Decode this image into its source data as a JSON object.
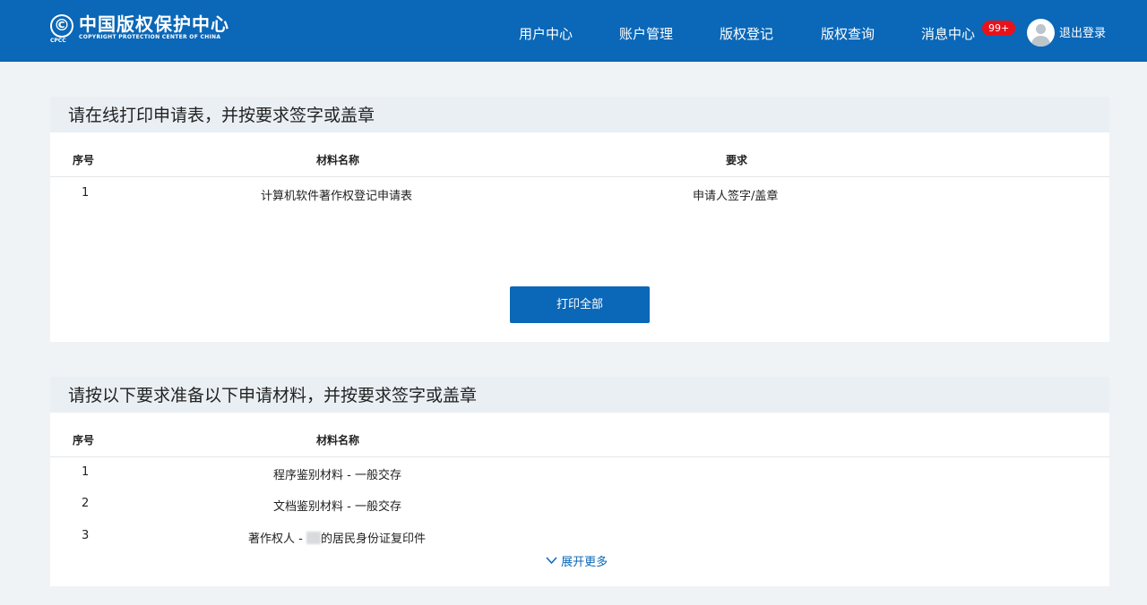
{
  "header": {
    "logo_cn": "中国版权保护中心",
    "logo_en": "COPYRIGHT PROTECTION CENTER OF CHINA",
    "logo_abbr": "CPCC",
    "nav": [
      "用户中心",
      "账户管理",
      "版权登记",
      "版权查询",
      "消息中心"
    ],
    "badge": "99+",
    "logout": "退出登录"
  },
  "section1": {
    "title": "请在线打印申请表，并按要求签字或盖章",
    "columns": [
      "序号",
      "材料名称",
      "要求"
    ],
    "rows": [
      {
        "no": "1",
        "name": "计算机软件著作权登记申请表",
        "req": "申请人签字/盖章"
      }
    ],
    "print_all": "打印全部"
  },
  "section2": {
    "title": "请按以下要求准备以下申请材料，并按要求签字或盖章",
    "columns": [
      "序号",
      "材料名称"
    ],
    "rows": [
      {
        "no": "1",
        "name": "程序鉴别材料 - 一般交存"
      },
      {
        "no": "2",
        "name": "文档鉴别材料 - 一般交存"
      },
      {
        "no": "3",
        "name_prefix": "著作权人 - ",
        "name_suffix": "的居民身份证复印件"
      }
    ],
    "expand_more": "展开更多"
  }
}
